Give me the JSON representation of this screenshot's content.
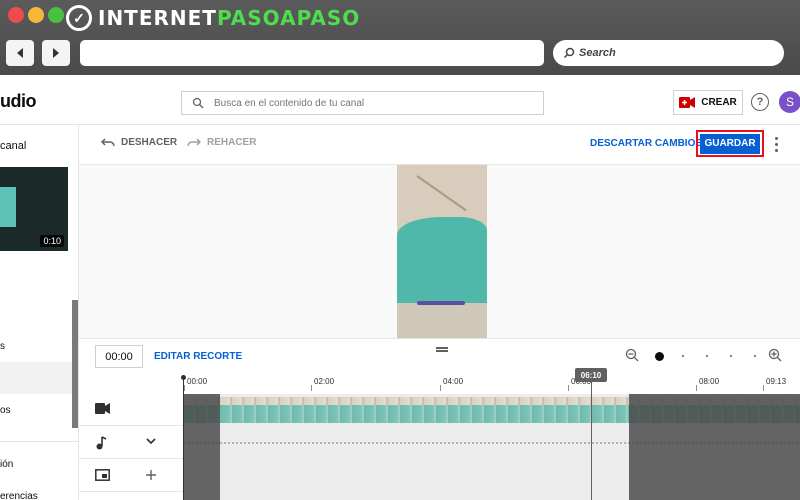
{
  "window": {
    "logo_prefix": "INTERNET",
    "logo_accent": "PASOAPASO",
    "search_label": "Search"
  },
  "studio": {
    "title": "udio",
    "search_placeholder": "Busca en el contenido de tu canal",
    "create_label": "CREAR",
    "help_label": "?",
    "avatar_letter": "S"
  },
  "sidebar": {
    "heading": "canal",
    "thumb_duration": "0:10",
    "items": [
      "s",
      "os",
      "ión",
      "erencias"
    ]
  },
  "toolbar": {
    "undo_label": "DESHACER",
    "redo_label": "REHACER",
    "discard_label": "DESCARTAR CAMBIOS",
    "save_label": "GUARDAR"
  },
  "timeline": {
    "current_time": "00:00",
    "trim_label": "EDITAR RECORTE",
    "ruler_ticks": [
      "00:00",
      "02:00",
      "04:00",
      "06:00",
      "08:00",
      "09:13"
    ],
    "cursor_time": "06:10"
  },
  "colors": {
    "accent_blue": "#065fd4",
    "annotation_red": "#e8101c",
    "create_red": "#cc0000"
  }
}
